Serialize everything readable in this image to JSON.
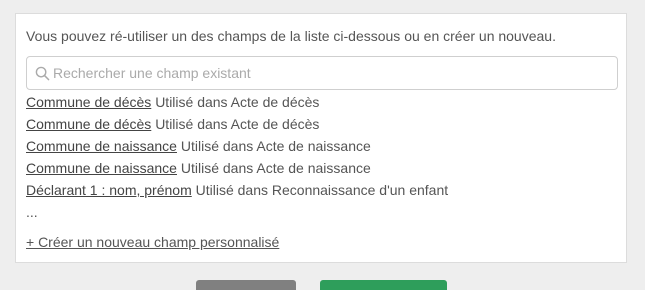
{
  "intro_text": "Vous pouvez ré-utiliser un des champs de la liste ci-dessous ou en créer un nouveau.",
  "search": {
    "placeholder": "Rechercher une champ existant",
    "value": "",
    "icon": "search-icon"
  },
  "fields": [
    {
      "name": "Commune de décès",
      "usage": "Utilisé dans Acte de décès"
    },
    {
      "name": "Commune de décès",
      "usage": "Utilisé dans Acte de décès"
    },
    {
      "name": "Commune de naissance",
      "usage": "Utilisé dans Acte de naissance"
    },
    {
      "name": "Commune de naissance",
      "usage": "Utilisé dans Acte de naissance"
    },
    {
      "name": "Déclarant 1 : nom, prénom",
      "usage": "Utilisé dans Reconnaissance d'un enfant"
    }
  ],
  "more_indicator": "...",
  "create_link": "+ Créer un nouveau champ personnalisé",
  "colors": {
    "primary_button": "#2e9e5b",
    "secondary_button": "#808080"
  }
}
